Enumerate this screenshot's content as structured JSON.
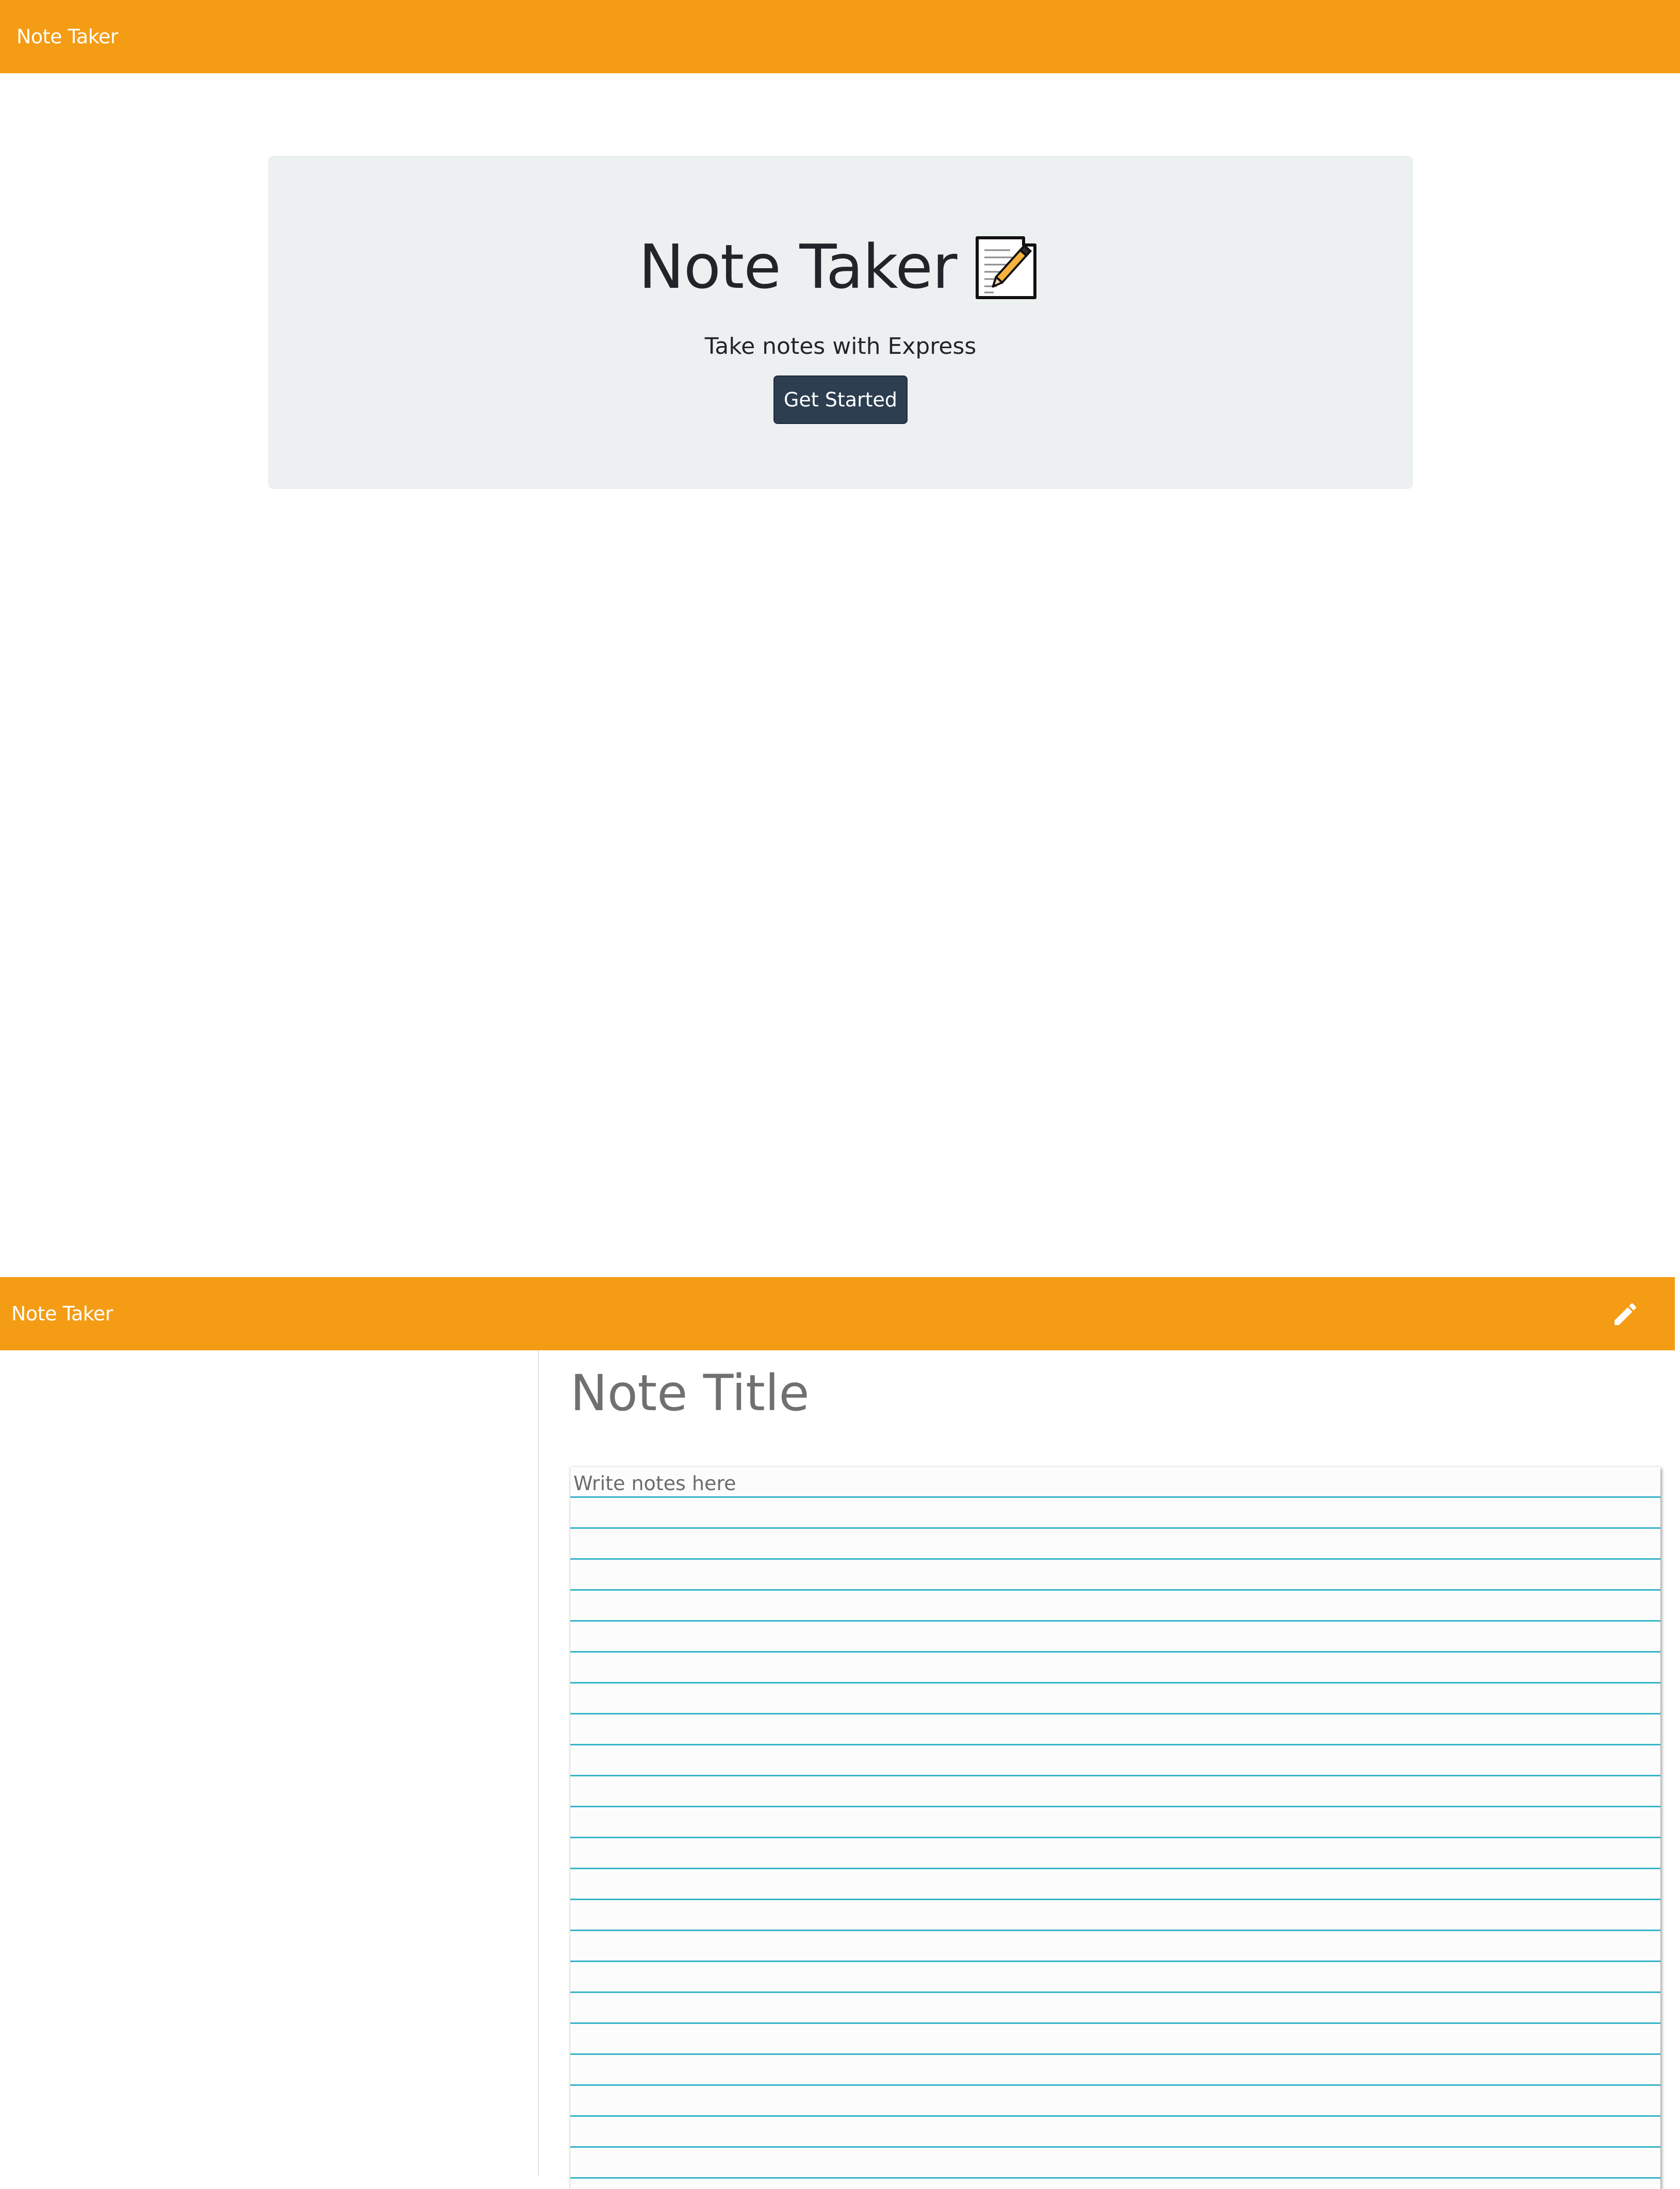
{
  "landing": {
    "navbar": {
      "brand": "Note Taker",
      "background_color": "#f49c14"
    },
    "jumbotron": {
      "title": "Note Taker",
      "title_icon": "memo-notepad-icon",
      "subtitle": "Take notes with Express",
      "button_label": "Get Started",
      "button_color": "#2c3e50",
      "background_color": "#ecf0f1"
    }
  },
  "notes": {
    "navbar": {
      "brand": "Note Taker",
      "new_note_icon": "pencil-icon",
      "background_color": "#f49c14"
    },
    "sidebar": {
      "items": []
    },
    "editor": {
      "title_placeholder": "Note Title",
      "title_value": "",
      "text_placeholder": "Write notes here",
      "text_value": "",
      "ruled_line_color": "#35b4c9"
    }
  }
}
